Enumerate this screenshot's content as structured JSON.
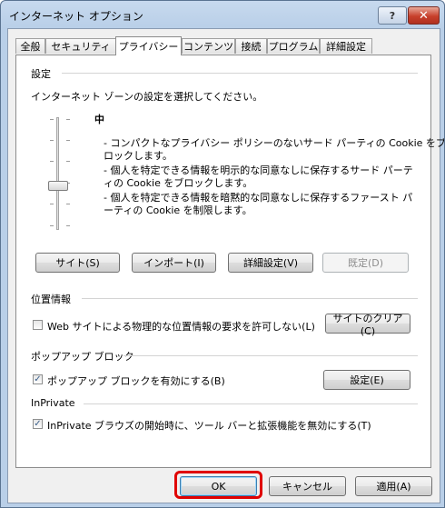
{
  "window": {
    "title": "インターネット オプション",
    "help_label": "?",
    "close_label": "✕"
  },
  "tabs": [
    {
      "label": "全般"
    },
    {
      "label": "セキュリティ"
    },
    {
      "label": "プライバシー",
      "active": true
    },
    {
      "label": "コンテンツ"
    },
    {
      "label": "接続"
    },
    {
      "label": "プログラム"
    },
    {
      "label": "詳細設定"
    }
  ],
  "settings": {
    "group_label": "設定",
    "instruction": "インターネット ゾーンの設定を選択してください。",
    "level_name": "中",
    "description_lines": [
      "- コンパクトなプライバシー ポリシーのないサード パーティの Cookie をブ",
      "ロックします。",
      "- 個人を特定できる情報を明示的な同意なしに保存するサード パーテ",
      "ィの Cookie をブロックします。",
      "- 個人を特定できる情報を暗黙的な同意なしに保存するファースト パ",
      "ーティの Cookie を制限します。"
    ],
    "buttons": {
      "sites": "サイト(S)",
      "import": "インポート(I)",
      "advanced": "詳細設定(V)",
      "default": "既定(D)"
    }
  },
  "location": {
    "group_label": "位置情報",
    "checkbox_label": "Web サイトによる物理的な位置情報の要求を許可しない(L)",
    "checked": false,
    "clear_button": "サイトのクリア(C)"
  },
  "popup": {
    "group_label": "ポップアップ ブロック",
    "checkbox_label": "ポップアップ ブロックを有効にする(B)",
    "checked": true,
    "settings_button": "設定(E)"
  },
  "inprivate": {
    "group_label": "InPrivate",
    "checkbox_label": "InPrivate ブラウズの開始時に、ツール バーと拡張機能を無効にする(T)",
    "checked": true
  },
  "footer": {
    "ok": "OK",
    "cancel": "キャンセル",
    "apply": "適用(A)"
  },
  "check_mark": "✓"
}
